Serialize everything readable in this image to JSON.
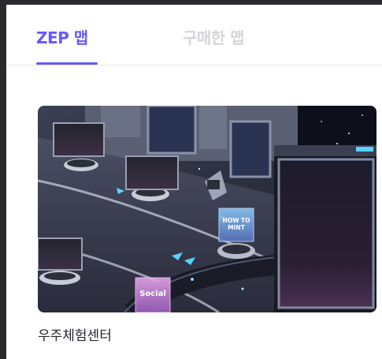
{
  "tabs": [
    {
      "label": "ZEP 맵",
      "active": true
    },
    {
      "label": "구매한 맵",
      "active": false
    }
  ],
  "colors": {
    "accent": "#6758ff",
    "inactive_tab": "#d4d4da"
  },
  "map_card": {
    "title": "우주체험센터",
    "sign_how_to_mint": "HOW TO\nMINT",
    "sign_social": "Social"
  }
}
